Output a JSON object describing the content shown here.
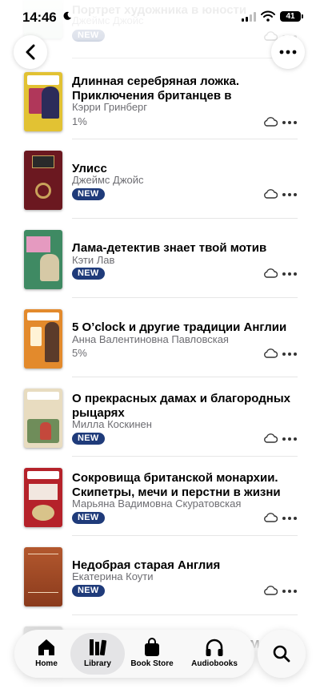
{
  "status": {
    "time": "14:46",
    "battery": "41"
  },
  "books": [
    {
      "title": "Портрет художника в юности",
      "author": "Джеймс Джойс",
      "badge": "NEW",
      "progress": null,
      "cover_color": "#d9e8dc"
    },
    {
      "title": "Длинная серебряная ложка. Приключения британцев в Трансильвании",
      "author": "Кэрри Гринберг",
      "badge": null,
      "progress": "1%",
      "cover_color": "#e2c233"
    },
    {
      "title": "Улисс",
      "author": "Джеймс Джойс",
      "badge": "NEW",
      "progress": null,
      "cover_color": "#6b1820"
    },
    {
      "title": "Лама-детектив знает твой мотив",
      "author": "Кэти Лав",
      "badge": "NEW",
      "progress": null,
      "cover_color": "#3f8a63"
    },
    {
      "title": "5 O’clock и другие традиции Англии",
      "author": "Анна Валентиновна Павловская",
      "badge": null,
      "progress": "5%",
      "cover_color": "#e38a2c"
    },
    {
      "title": "О прекрасных дамах и благородных рыцарях",
      "author": "Милла Коскинен",
      "badge": "NEW",
      "progress": null,
      "cover_color": "#e8dcc0"
    },
    {
      "title": "Сокровища британской монархии. Скипетры, мечи и перстни в жизни англи...",
      "author": "Марьяна Вадимовна Скуратовская",
      "badge": "NEW",
      "progress": null,
      "cover_color": "#b5222a"
    },
    {
      "title": "Недобрая старая Англия",
      "author": "Екатерина Коути",
      "badge": "NEW",
      "progress": null,
      "cover_color": "#a8502a"
    },
    {
      "title": "М",
      "author": "",
      "badge": null,
      "progress": null,
      "cover_color": "#cfcfcf"
    }
  ],
  "tabs": [
    {
      "label": "Home",
      "icon": "home-icon"
    },
    {
      "label": "Library",
      "icon": "library-icon"
    },
    {
      "label": "Book Store",
      "icon": "bag-icon"
    },
    {
      "label": "Audiobooks",
      "icon": "headphones-icon"
    }
  ],
  "colors": {
    "badge": "#1f3b7a",
    "secondary_text": "#6d6d72"
  }
}
